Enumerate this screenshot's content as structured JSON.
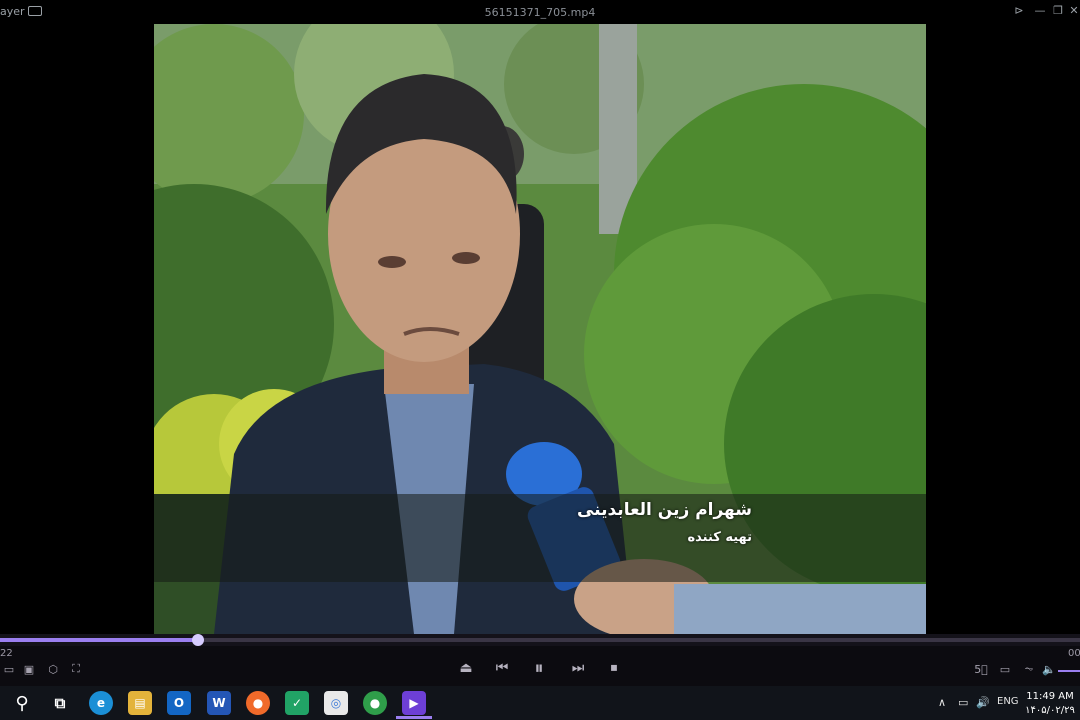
{
  "window": {
    "app_name": "ayer",
    "title": "56151371_705.mp4",
    "buttons": {
      "pin": "⊳",
      "minimize": "—",
      "maximize": "❐",
      "close": "✕"
    }
  },
  "video": {
    "caption_name": "شهرام زین العابدینی",
    "caption_role": "تهیه کننده"
  },
  "playback": {
    "progress": 0.183,
    "time_elapsed": "22",
    "time_remaining": "00"
  },
  "controls": {
    "left": [
      {
        "icon": "playlist-icon",
        "glyph": "▭"
      },
      {
        "icon": "subtitle-icon",
        "glyph": "▣"
      },
      {
        "icon": "3d-icon",
        "glyph": "⬡"
      },
      {
        "icon": "capture-icon",
        "glyph": "⛶"
      }
    ],
    "center": [
      {
        "icon": "eject-icon",
        "glyph": "⏏"
      },
      {
        "icon": "previous-icon",
        "glyph": "⏮"
      },
      {
        "icon": "pause-icon",
        "glyph": "⏸"
      },
      {
        "icon": "next-icon",
        "glyph": "⏭"
      },
      {
        "icon": "stop-icon",
        "glyph": "⏹"
      }
    ],
    "right": [
      {
        "icon": "vr-icon",
        "glyph": "5⃣"
      },
      {
        "icon": "subtitles-cc-icon",
        "glyph": "▭"
      },
      {
        "icon": "audio-icon",
        "glyph": "⏦"
      },
      {
        "icon": "volume-icon",
        "glyph": "🔈"
      }
    ]
  },
  "taskbar": {
    "apps": [
      {
        "name": "search-icon",
        "glyph": "⚲",
        "color": "#11141a"
      },
      {
        "name": "task-view-icon",
        "glyph": "⧉",
        "color": "#11141a"
      },
      {
        "name": "edge-icon",
        "glyph": "e",
        "color": "#1b8fd6"
      },
      {
        "name": "file-explorer-icon",
        "glyph": "▤",
        "color": "#e3b33b"
      },
      {
        "name": "outlook-icon",
        "glyph": "O",
        "color": "#1366c4"
      },
      {
        "name": "word-icon",
        "glyph": "W",
        "color": "#2456b6"
      },
      {
        "name": "firefox-icon",
        "glyph": "●",
        "color": "#f06a2a"
      },
      {
        "name": "shield-app-icon",
        "glyph": "✓",
        "color": "#21a366"
      },
      {
        "name": "photos-icon",
        "glyph": "◎",
        "color": "#e9e9e9"
      },
      {
        "name": "chrome-icon",
        "glyph": "●",
        "color": "#2f9e4a"
      },
      {
        "name": "media-player-icon",
        "glyph": "▶",
        "color": "#6d3fd6"
      }
    ],
    "tray": {
      "chevron": "∧",
      "network": "▭",
      "volume": "🔊",
      "language": "ENG",
      "time": "11:49 AM",
      "date": "۱۴۰۵/۰۲/۲۹"
    }
  }
}
